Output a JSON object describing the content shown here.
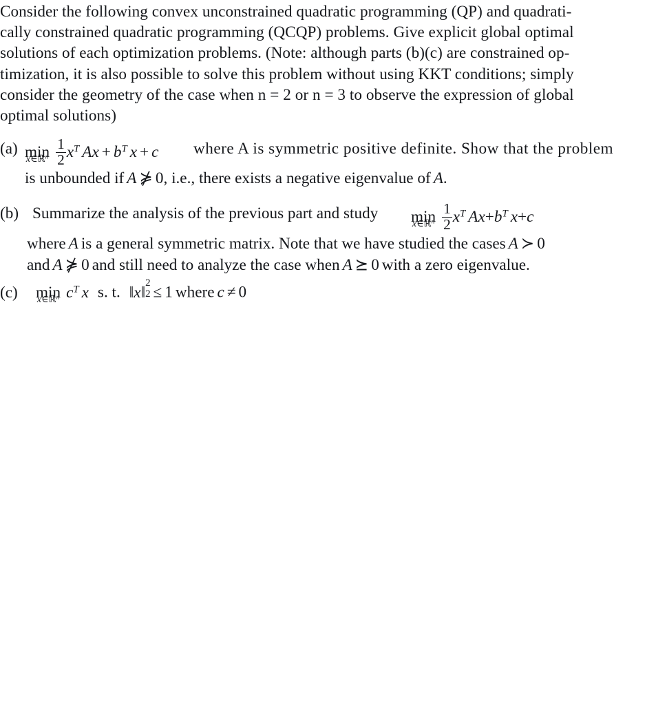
{
  "document": {
    "type": "math-problem-set",
    "text_color": "#16181c",
    "background_color": "#ffffff",
    "intro": {
      "lines": [
        "Consider the following convex unconstrained quadratic programming (QP) and quadrati-",
        "cally constrained quadratic programming (QCQP) problems. Give explicit global optimal",
        "solutions of each optimization problems. (Note: although parts (b)(c) are constrained op-",
        "timization, it is also possible to solve this problem without using KKT conditions; simply",
        "consider the geometry of the case when n = 2 or n = 3 to observe the expression of global",
        "optimal solutions)"
      ],
      "full_text": "Consider the following convex unconstrained quadratic programming (QP) and quadratically constrained quadratic programming (QCQP) problems. Give explicit global optimal solutions of each optimization problems. (Note: although parts (b)(c) are constrained optimization, it is also possible to solve this problem without using KKT conditions; simply consider the geometry of the case when n = 2 or n = 3 to observe the expression of global optimal solutions)"
    },
    "parts": [
      {
        "tag": "(a)",
        "objective_text": "min_{x∈R^n} (1/2) x^T A x + b^T x + c",
        "min_label": "min",
        "min_limit": "x∈ℝⁿ",
        "frac_num": "1",
        "frac_den": "2",
        "after_math": "where A is symmetric positive definite. Show that the problem",
        "line2": "is unbounded if A ⋡ 0, i.e., there exists a negative eigenvalue of A.",
        "line2_parts": {
          "before": "is unbounded if",
          "matrix": "A",
          "relation": "⋡",
          "zero": "0",
          "after": ", i.e., there exists a negative eigenvalue of",
          "matrix_end": "A",
          "period": "."
        }
      },
      {
        "tag": "(b)",
        "lead_text": "Summarize the analysis of the previous part and study",
        "objective_text": "min_{x∈R^n} (1/2) x^T A x + b^T x + c",
        "min_label": "min",
        "min_limit": "x∈ℝⁿ",
        "frac_num": "1",
        "frac_den": "2",
        "line2": "where A is a general symmetric matrix. Note that we have studied the cases A ≻ 0",
        "line3": "and A ⋡ 0 and still need to analyze the case when A ⪰ 0 with a zero eigenvalue.",
        "line2_parts": {
          "before": "where",
          "matrix": "A",
          "mid": "is a general symmetric matrix.  Note that we have studied the cases",
          "matrix2": "A",
          "relation": "≻",
          "zero": "0"
        },
        "line3_parts": {
          "before": "and",
          "matrix": "A",
          "relation": "⋡",
          "zero": "0",
          "mid": "and still need to analyze the case when",
          "matrix2": "A",
          "relation2": "⪰",
          "zero2": "0",
          "after": "with a zero eigenvalue."
        }
      },
      {
        "tag": "(c)",
        "objective_text": "min_{x∈R^n} c^T x  s.t.  ||x||_2^2 ≤ 1 where c ≠ 0",
        "min_label": "min",
        "min_limit": "x∈ℝⁿ",
        "subject_to": "s. t.",
        "norm_sub": "2",
        "norm_sup": "2",
        "inequality": "≤",
        "bound": "1",
        "where_text": "where",
        "vector": "c",
        "neq": "≠",
        "zero": "0"
      }
    ]
  }
}
